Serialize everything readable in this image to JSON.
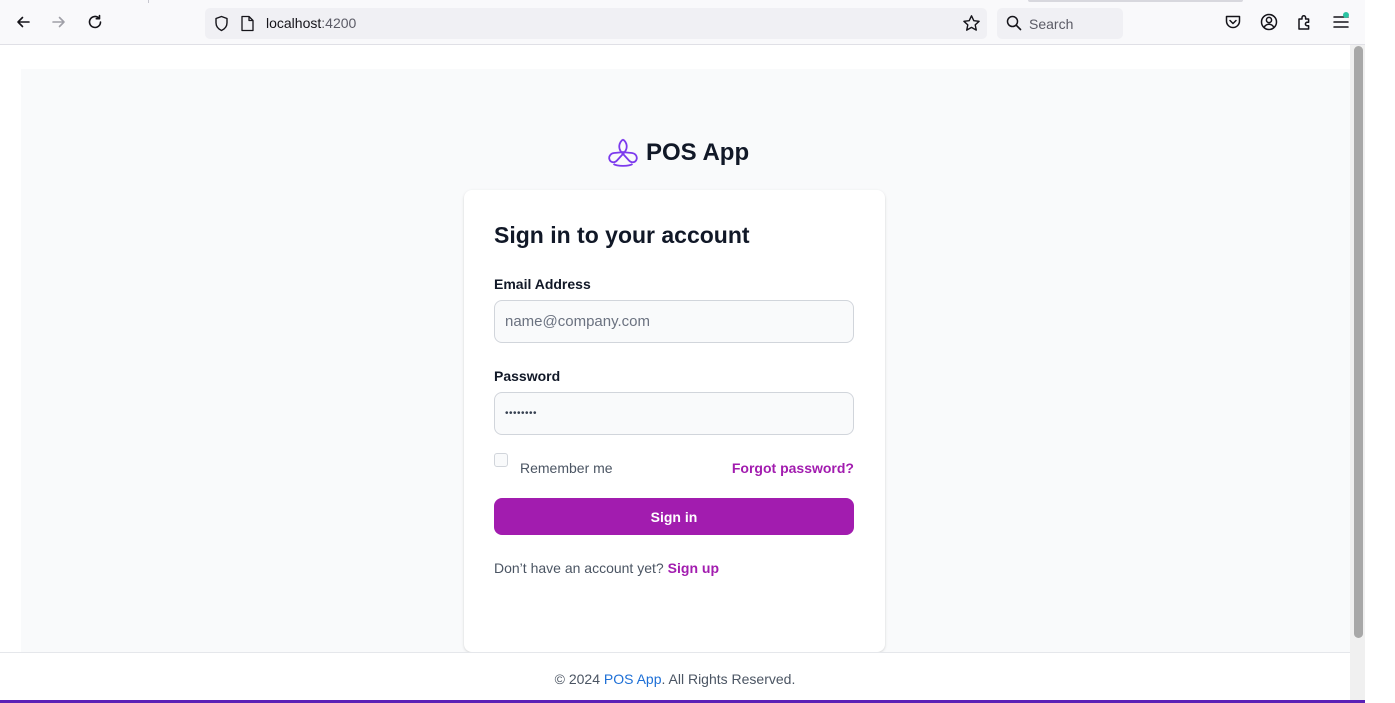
{
  "browser": {
    "url_host": "localhost",
    "url_port": ":4200",
    "search_placeholder": "Search",
    "icons": {
      "back": "arrow-left-icon",
      "forward": "arrow-right-icon",
      "reload": "reload-icon",
      "tracking": "shield-icon",
      "page": "page-icon",
      "bookmark": "star-icon",
      "search": "search-icon",
      "pocket": "pocket-icon",
      "account": "account-icon",
      "extensions": "puzzle-icon",
      "menu": "hamburger-menu-icon"
    }
  },
  "brand": {
    "name": "POS App",
    "logo_icon": "knot-logo-icon"
  },
  "login": {
    "title": "Sign in to your account",
    "email_label": "Email Address",
    "email_placeholder": "name@company.com",
    "password_label": "Password",
    "password_mask": "••••••••",
    "remember_label": "Remember me",
    "forgot_label": "Forgot password?",
    "submit_label": "Sign in",
    "signup_prompt": "Don’t have an account yet?",
    "signup_link": "Sign up"
  },
  "footer": {
    "copyright": "© 2024",
    "brand_link": "POS App",
    "rights": ". All Rights Reserved."
  },
  "colors": {
    "accent": "#a21caf",
    "footer_link": "#1d6fd6",
    "page_background": "#f9fafb"
  }
}
